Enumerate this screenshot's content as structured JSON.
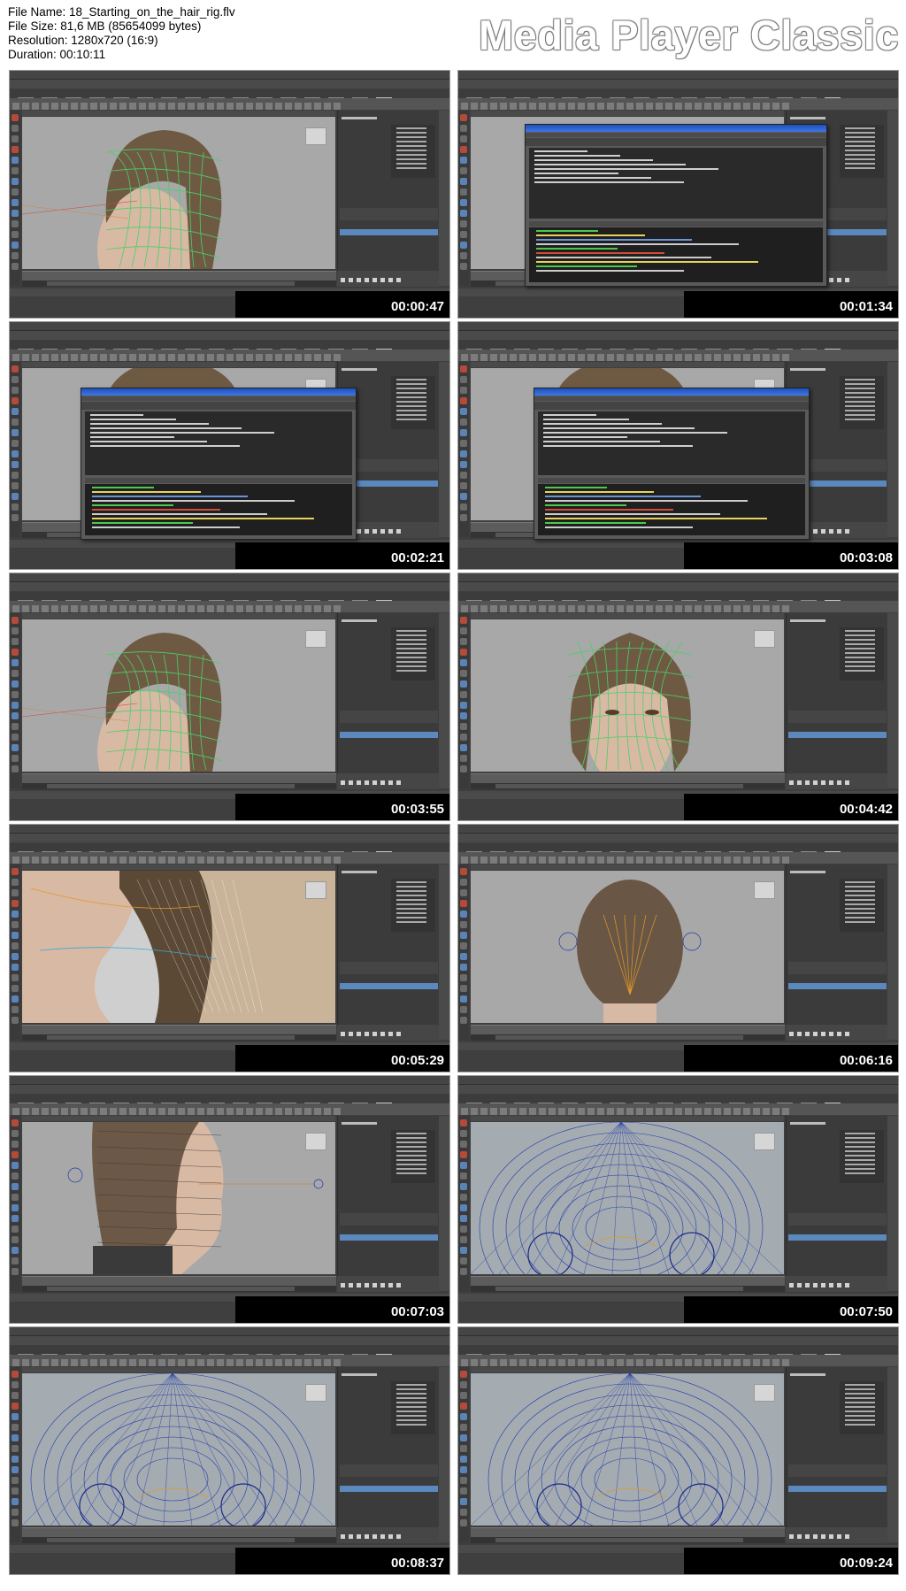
{
  "file_info": {
    "file_name": "File Name: 18_Starting_on_the_hair_rig.flv",
    "file_size": "File Size: 81,6 MB (85654099 bytes)",
    "resolution": "Resolution: 1280x720 (16:9)",
    "duration": "Duration: 00:10:11"
  },
  "brand": "Media Player Classic",
  "thumbnails": [
    {
      "timestamp": "00:00:47",
      "scene": "head-side",
      "script_editor": false
    },
    {
      "timestamp": "00:01:34",
      "scene": "viewport",
      "script_editor": true
    },
    {
      "timestamp": "00:02:21",
      "scene": "head-top",
      "script_editor": true
    },
    {
      "timestamp": "00:03:08",
      "scene": "head-top",
      "script_editor": true
    },
    {
      "timestamp": "00:03:55",
      "scene": "head-side",
      "script_editor": false
    },
    {
      "timestamp": "00:04:42",
      "scene": "head-front",
      "script_editor": false
    },
    {
      "timestamp": "00:05:29",
      "scene": "closeup-side",
      "script_editor": false
    },
    {
      "timestamp": "00:06:16",
      "scene": "back-head",
      "script_editor": false
    },
    {
      "timestamp": "00:07:03",
      "scene": "side-profile",
      "script_editor": false
    },
    {
      "timestamp": "00:07:50",
      "scene": "wireframe",
      "script_editor": false
    },
    {
      "timestamp": "00:08:37",
      "scene": "wireframe",
      "script_editor": false
    },
    {
      "timestamp": "00:09:24",
      "scene": "wireframe-front",
      "script_editor": false
    }
  ],
  "colors": {
    "maya_ui": "#3e3e3e",
    "viewport_bg": "#a8a8a8",
    "hair": "#6e5a43",
    "skin": "#d8b9a4",
    "wire_green": "#4ccf69",
    "wire_blue": "#1f3aa8",
    "selection_blue": "#5b88bd"
  }
}
